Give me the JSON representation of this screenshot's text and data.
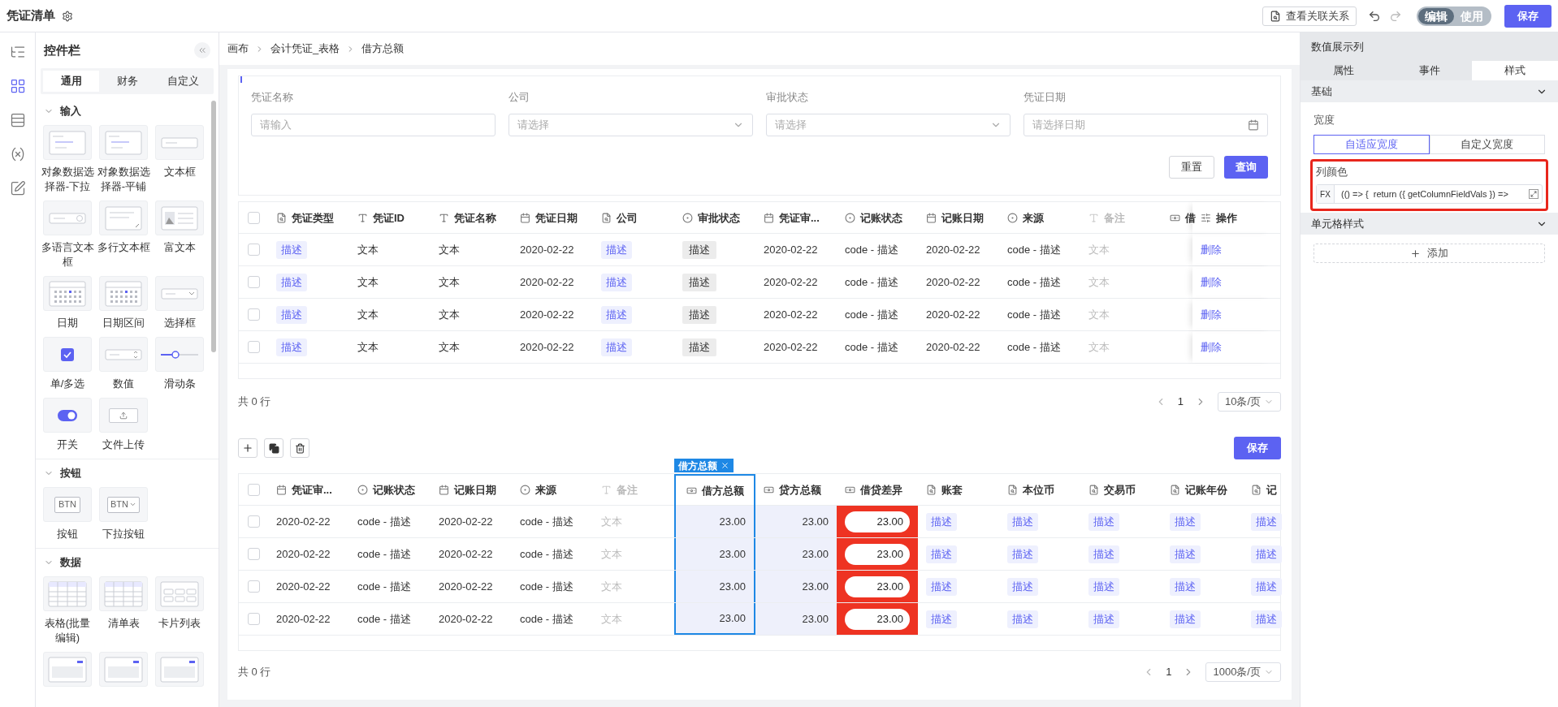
{
  "app_bar": {
    "title": "凭证清单",
    "relations_button": "查看关联关系",
    "mode_toggle": [
      {
        "label": "编辑",
        "selected": true
      },
      {
        "label": "使用",
        "selected": false
      }
    ],
    "save_button": "保存"
  },
  "rail": [
    {
      "kind": "tree",
      "selected": false
    },
    {
      "kind": "grid",
      "selected": true
    },
    {
      "kind": "rows",
      "selected": false
    },
    {
      "kind": "variable",
      "selected": false
    },
    {
      "kind": "edit",
      "selected": false
    }
  ],
  "widget_panel": {
    "title": "控件栏",
    "tabs": [
      {
        "label": "通用",
        "selected": true
      },
      {
        "label": "财务",
        "selected": false
      },
      {
        "label": "自定义",
        "selected": false
      }
    ],
    "groups": [
      {
        "title": "输入",
        "expanded": true,
        "items": [
          {
            "kind": "list",
            "label": "对象数据选择器-下拉"
          },
          {
            "kind": "list",
            "label": "对象数据选择器-平铺"
          },
          {
            "kind": "input",
            "label": "文本框"
          },
          {
            "kind": "i18n",
            "label": "多语言文本框"
          },
          {
            "kind": "textarea",
            "label": "多行文本框"
          },
          {
            "kind": "richtext",
            "label": "富文本"
          },
          {
            "kind": "calendar",
            "label": "日期"
          },
          {
            "kind": "calendar",
            "label": "日期区间"
          },
          {
            "kind": "select",
            "label": "选择框"
          },
          {
            "kind": "checkbox",
            "label": "单/多选"
          },
          {
            "kind": "number",
            "label": "数值"
          },
          {
            "kind": "slider",
            "label": "滑动条"
          },
          {
            "kind": "switch",
            "label": "开关"
          },
          {
            "kind": "upload",
            "label": "文件上传"
          }
        ]
      },
      {
        "title": "按钮",
        "expanded": true,
        "items": [
          {
            "kind": "button",
            "thumb_text": "BTN",
            "label": "按钮"
          },
          {
            "kind": "dropdown-button",
            "thumb_text": "BTN",
            "label": "下拉按钮"
          }
        ]
      },
      {
        "title": "数据",
        "expanded": true,
        "items": [
          {
            "kind": "table",
            "label": "表格(批量编辑)"
          },
          {
            "kind": "table",
            "label": "清单表"
          },
          {
            "kind": "cards",
            "label": "卡片列表"
          },
          {
            "kind": "panel"
          },
          {
            "kind": "panel"
          },
          {
            "kind": "panel"
          }
        ]
      }
    ]
  },
  "breadcrumb": [
    "画布",
    "会计凭证_表格",
    "借方总额"
  ],
  "filter": {
    "fields": [
      {
        "label": "凭证名称",
        "placeholder": "请输入",
        "kind": "text"
      },
      {
        "label": "公司",
        "placeholder": "请选择",
        "kind": "select"
      },
      {
        "label": "审批状态",
        "placeholder": "请选择",
        "kind": "select"
      },
      {
        "label": "凭证日期",
        "placeholder": "请选择日期",
        "kind": "date"
      }
    ],
    "reset_button": "重置",
    "search_button": "查询"
  },
  "table_1": {
    "all_checked": false,
    "columns": [
      {
        "label": "凭证类型",
        "kind": "tag",
        "selected": false
      },
      {
        "label": "凭证ID",
        "kind": "text",
        "selected": false
      },
      {
        "label": "凭证名称",
        "kind": "text",
        "selected": false
      },
      {
        "label": "凭证日期",
        "kind": "date",
        "selected": false
      },
      {
        "label": "公司",
        "kind": "tag",
        "selected": false
      },
      {
        "label": "审批状态",
        "kind": "gray-tag",
        "selected": false
      },
      {
        "label": "凭证审...",
        "kind": "date",
        "selected": false
      },
      {
        "label": "记账状态",
        "kind": "code",
        "selected": false
      },
      {
        "label": "记账日期",
        "kind": "date",
        "selected": false
      },
      {
        "label": "来源",
        "kind": "code",
        "selected": false
      },
      {
        "label": "备注",
        "kind": "muted",
        "selected": false
      },
      {
        "label": "借",
        "kind": "covered",
        "selected": false
      },
      {
        "label": "操作",
        "kind": "link",
        "selected": false
      }
    ],
    "rows": [
      {
        "checked": false,
        "cells": [
          "描述",
          "文本",
          "文本",
          "2020-02-22",
          "描述",
          "描述",
          "2020-02-22",
          "code - 描述",
          "2020-02-22",
          "code - 描述",
          "文本",
          "删除"
        ]
      },
      {
        "checked": false,
        "cells": [
          "描述",
          "文本",
          "文本",
          "2020-02-22",
          "描述",
          "描述",
          "2020-02-22",
          "code - 描述",
          "2020-02-22",
          "code - 描述",
          "文本",
          "删除"
        ]
      },
      {
        "checked": false,
        "cells": [
          "描述",
          "文本",
          "文本",
          "2020-02-22",
          "描述",
          "描述",
          "2020-02-22",
          "code - 描述",
          "2020-02-22",
          "code - 描述",
          "文本",
          "删除"
        ]
      },
      {
        "checked": false,
        "cells": [
          "描述",
          "文本",
          "文本",
          "2020-02-22",
          "描述",
          "描述",
          "2020-02-22",
          "code - 描述",
          "2020-02-22",
          "code - 描述",
          "文本",
          "删除"
        ]
      }
    ],
    "footer": {
      "total": "共 0 行",
      "page": "1",
      "page_size": "10条/页"
    }
  },
  "table_2": {
    "save_button": "保存",
    "selection_tag": "借方总额",
    "all_checked": false,
    "columns": [
      {
        "label": "凭证审...",
        "kind": "date",
        "selected": false
      },
      {
        "label": "记账状态",
        "kind": "code",
        "selected": false
      },
      {
        "label": "记账日期",
        "kind": "date",
        "selected": false
      },
      {
        "label": "来源",
        "kind": "code",
        "selected": false
      },
      {
        "label": "备注",
        "kind": "muted",
        "selected": false
      },
      {
        "label": "借方总额",
        "kind": "amount",
        "selected": true
      },
      {
        "label": "贷方总额",
        "kind": "amount",
        "selected": false
      },
      {
        "label": "借贷差异",
        "kind": "amount",
        "color": "#ee3322",
        "selected": false
      },
      {
        "label": "账套",
        "kind": "tag",
        "selected": false
      },
      {
        "label": "本位币",
        "kind": "tag",
        "selected": false
      },
      {
        "label": "交易币",
        "kind": "tag",
        "selected": false
      },
      {
        "label": "记账年份",
        "kind": "tag",
        "selected": false
      },
      {
        "label": "记",
        "kind": "tag",
        "clipped": true,
        "selected": false
      }
    ],
    "rows": [
      {
        "checked": false,
        "cells": [
          "2020-02-22",
          "code - 描述",
          "2020-02-22",
          "code - 描述",
          "文本",
          "23.00",
          "23.00",
          "23.00",
          "描述",
          "描述",
          "描述",
          "描述",
          "描述"
        ]
      },
      {
        "checked": false,
        "cells": [
          "2020-02-22",
          "code - 描述",
          "2020-02-22",
          "code - 描述",
          "文本",
          "23.00",
          "23.00",
          "23.00",
          "描述",
          "描述",
          "描述",
          "描述",
          "描述"
        ]
      },
      {
        "checked": false,
        "cells": [
          "2020-02-22",
          "code - 描述",
          "2020-02-22",
          "code - 描述",
          "文本",
          "23.00",
          "23.00",
          "23.00",
          "描述",
          "描述",
          "描述",
          "描述",
          "描述"
        ]
      },
      {
        "checked": false,
        "cells": [
          "2020-02-22",
          "code - 描述",
          "2020-02-22",
          "code - 描述",
          "文本",
          "23.00",
          "23.00",
          "23.00",
          "描述",
          "描述",
          "描述",
          "描述",
          "描述"
        ]
      }
    ],
    "footer": {
      "total": "共 0 行",
      "page": "1",
      "page_size": "1000条/页"
    }
  },
  "inspector": {
    "title": "数值展示列",
    "tabs": [
      {
        "label": "属性",
        "selected": false
      },
      {
        "label": "事件",
        "selected": false
      },
      {
        "label": "样式",
        "selected": true
      }
    ],
    "basic_section": {
      "title": "基础",
      "expanded": true,
      "width_label": "宽度",
      "width_options": [
        {
          "label": "自适应宽度",
          "selected": true
        },
        {
          "label": "自定义宽度",
          "selected": false
        }
      ],
      "color_label": "列颜色",
      "formula_prefix": "FX",
      "formula": "(() => {  return ({ getColumnFieldVals }) =>"
    },
    "cell_style_section": {
      "title": "单元格样式",
      "expanded": true,
      "add_button": "添加"
    }
  }
}
